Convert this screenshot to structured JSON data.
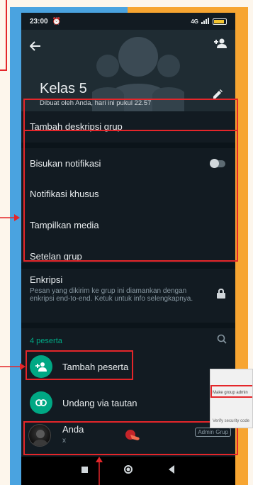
{
  "status_bar": {
    "time": "23:00",
    "network": "4G"
  },
  "header": {
    "group_name": "Kelas 5",
    "created_by": "Dibuat oleh Anda, hari ini pukul 22.57"
  },
  "menu": {
    "add_description": "Tambah deskripsi grup",
    "mute_notifications": "Bisukan notifikasi",
    "custom_notifications": "Notifikasi khusus",
    "show_media": "Tampilkan media",
    "group_settings": "Setelan grup"
  },
  "encryption": {
    "title": "Enkripsi",
    "description": "Pesan yang dikirim ke grup ini diamankan dengan enkripsi end-to-end. Ketuk untuk info selengkapnya."
  },
  "participants": {
    "count_label": "4 peserta",
    "add_label": "Tambah peserta",
    "invite_label": "Undang via tautan",
    "members": [
      {
        "name": "Anda",
        "status": "x",
        "badge": "Admin Grup"
      }
    ]
  },
  "popup": {
    "item1": "Make group admin",
    "item2": "Verify security code"
  },
  "colors": {
    "accent": "#00a884",
    "annotation": "#e4262a",
    "background": "#121b22",
    "header": "#1f2c33"
  }
}
